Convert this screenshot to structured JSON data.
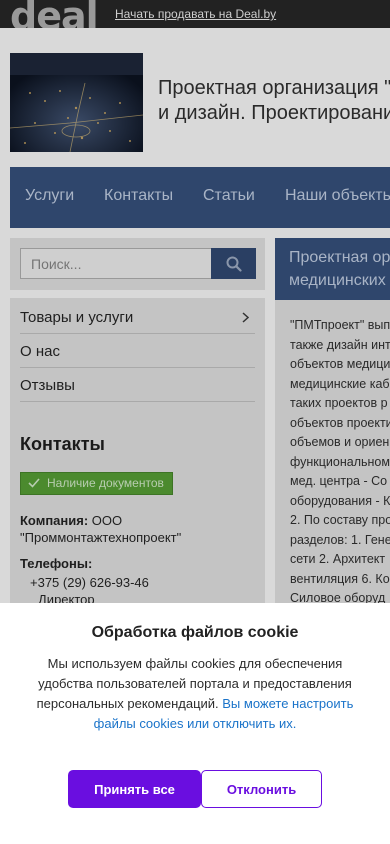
{
  "topbar": {
    "logo": "deal",
    "sell_link": "Начать продавать на Deal.by"
  },
  "hero": {
    "title": "Проектная организация \"\nи дизайн. Проектировани"
  },
  "nav": {
    "items": [
      "Услуги",
      "Контакты",
      "Статьи",
      "Наши объекть"
    ]
  },
  "search": {
    "placeholder": "Поиск..."
  },
  "sidebar": {
    "items": [
      {
        "label": "Товары и услуги"
      },
      {
        "label": "О нас"
      },
      {
        "label": "Отзывы"
      }
    ],
    "contacts_title": "Контакты",
    "docs_badge": "Наличие документов",
    "company_label": "Компания:",
    "company_value": "ООО \"Проммонтажтехнопроект\"",
    "phones_label": "Телефоны:",
    "phone": "+375 (29) 626-93-46",
    "phone_role": "Директор"
  },
  "content": {
    "title": "Проектная ор\nмедицинских",
    "text": "\"ПМТпроект\" вып\nтакже дизайн инт\nобъектов медици\nмедицинские каб\nтаких проектов р\nобъектов проекти\nобъемов и ориен\nфункциональном\nмед. центра - Со\nоборудования - К\n2. По составу про\nразделов: 1. Гене\nсети 2. Архитект\nвентиляция 6. Ко\nСиловое оборуд\nрадиационной за"
  },
  "cookie": {
    "title": "Обработка файлов cookie",
    "text": "Мы используем файлы cookies для обеспечения удобства пользователей портала и предоставления персональных рекомендаций. ",
    "link": "Вы можете настроить файлы cookies или отключить их.",
    "accept": "Принять все",
    "reject": "Отклонить"
  },
  "colors": {
    "accent": "#6a0ee0",
    "link": "#1a73c9",
    "nav_bg": "#2f466c"
  }
}
